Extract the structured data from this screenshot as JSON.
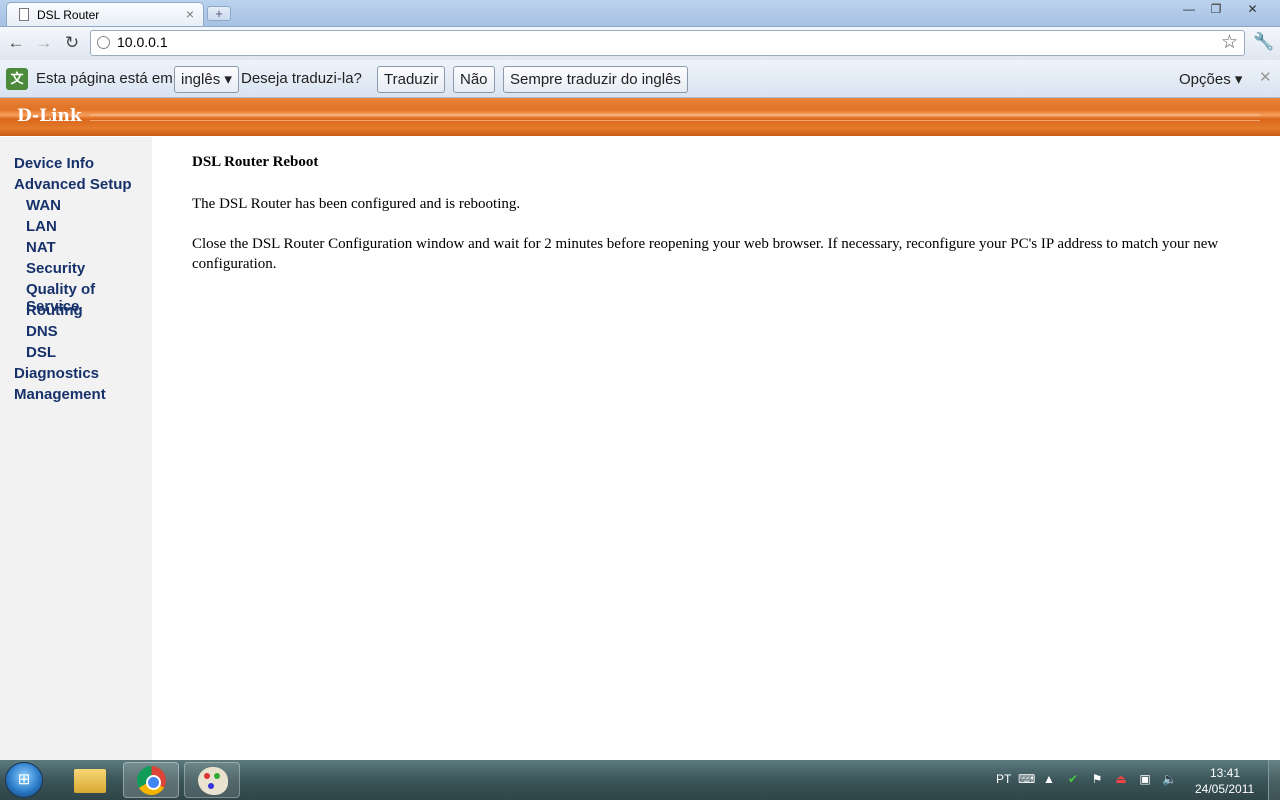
{
  "browser": {
    "tab_title": "DSL Router",
    "new_tab_symbol": "+",
    "url": "10.0.0.1"
  },
  "translate_bar": {
    "prefix": "Esta página está em",
    "language": "inglês ▾",
    "question": "Deseja traduzi-la?",
    "translate_button": "Traduzir",
    "no_button": "Não",
    "always_button": "Sempre traduzir do inglês",
    "options": "Opções ▾"
  },
  "header": {
    "brand": "D-Link"
  },
  "sidebar": {
    "items": [
      {
        "label": "Device Info"
      },
      {
        "label": "Advanced Setup"
      },
      {
        "label": "WAN"
      },
      {
        "label": "LAN"
      },
      {
        "label": "NAT"
      },
      {
        "label": "Security"
      },
      {
        "label": "Quality of Service"
      },
      {
        "label": "Routing"
      },
      {
        "label": "DNS"
      },
      {
        "label": "DSL"
      },
      {
        "label": "Diagnostics"
      },
      {
        "label": "Management"
      }
    ]
  },
  "main": {
    "title": "DSL Router Reboot",
    "line1": "The DSL Router has been configured and is rebooting.",
    "line2": "Close the DSL Router Configuration window and wait for 2 minutes before reopening your web browser. If necessary, reconfigure your PC's IP address to match your new configuration."
  },
  "taskbar": {
    "language": "PT",
    "time": "13:41",
    "date": "24/05/2011"
  },
  "colors": {
    "accent_orange": "#e07224",
    "link_blue": "#17326b",
    "sidebar_bg": "#f2f2f2"
  }
}
